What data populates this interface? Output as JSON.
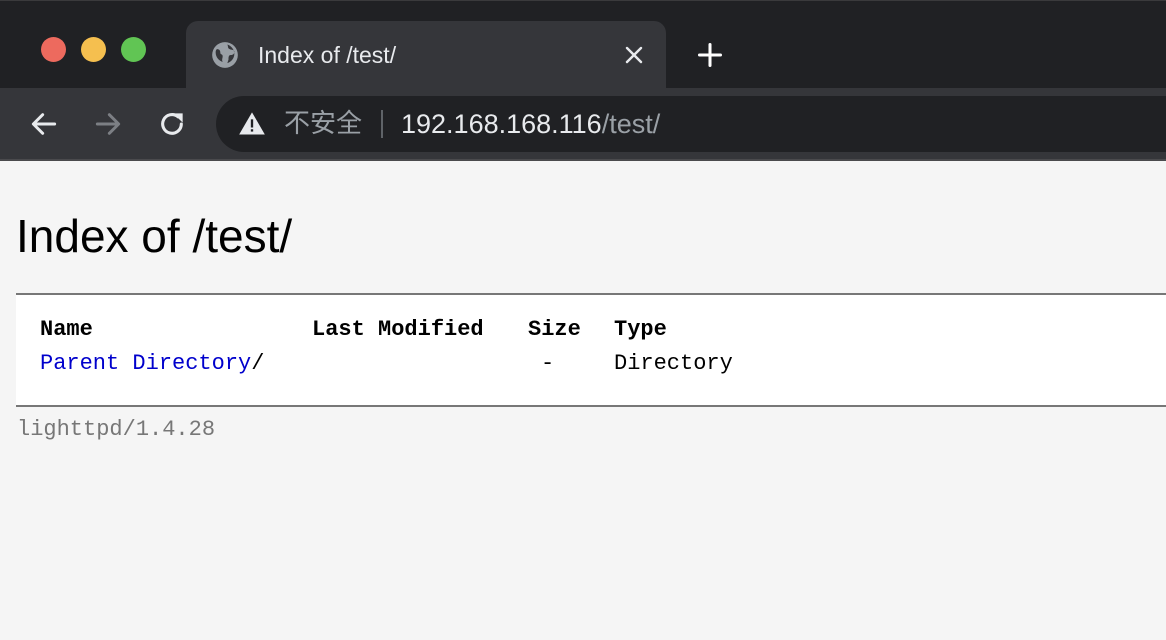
{
  "browser": {
    "tab_title": "Index of /test/",
    "insecure_label": "不安全",
    "url_host": "192.168.168.116",
    "url_path": "/test/",
    "icons": [
      "globe-icon",
      "close-icon",
      "plus-icon",
      "back-arrow-icon",
      "forward-arrow-icon",
      "reload-icon",
      "warning-icon"
    ]
  },
  "page": {
    "title": "Index of /test/",
    "columns": {
      "name": "Name",
      "last_modified": "Last Modified",
      "size": "Size",
      "type": "Type"
    },
    "rows": [
      {
        "name_link": "Parent Directory",
        "name_suffix": "/",
        "last_modified": "",
        "size": "-",
        "type": "Directory"
      }
    ],
    "footer": "lighttpd/1.4.28"
  },
  "colors": {
    "chrome_dark": "#202124",
    "chrome_tab": "#35363a",
    "link": "#0000cc",
    "page_bg": "#f5f5f5"
  }
}
